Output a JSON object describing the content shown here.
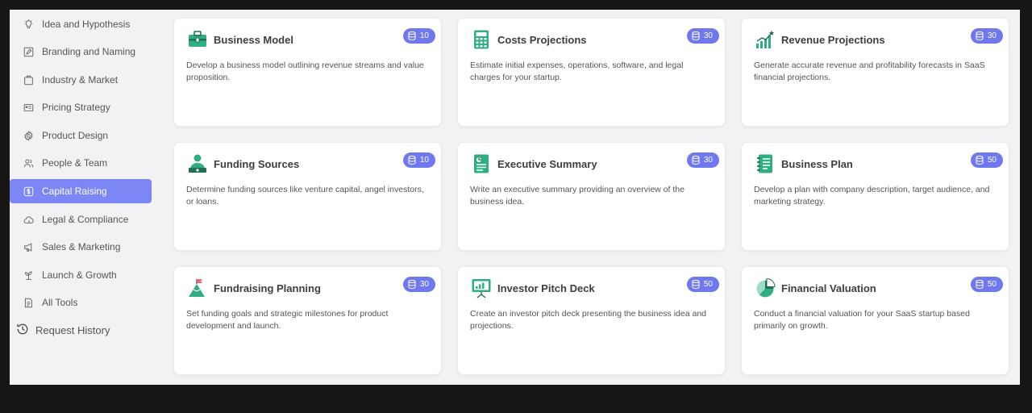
{
  "sidebar": {
    "items": [
      {
        "label": "Idea and Hypothesis",
        "icon": "lightbulb-icon",
        "active": false
      },
      {
        "label": "Branding and Naming",
        "icon": "edit-icon",
        "active": false
      },
      {
        "label": "Industry & Market",
        "icon": "briefcase-icon",
        "active": false
      },
      {
        "label": "Pricing Strategy",
        "icon": "price-tag-icon",
        "active": false
      },
      {
        "label": "Product Design",
        "icon": "gear-icon",
        "active": false
      },
      {
        "label": "People & Team",
        "icon": "people-icon",
        "active": false
      },
      {
        "label": "Capital Raising",
        "icon": "dollar-coin-icon",
        "active": true
      },
      {
        "label": "Legal & Compliance",
        "icon": "cloud-icon",
        "active": false
      },
      {
        "label": "Sales & Marketing",
        "icon": "megaphone-icon",
        "active": false
      },
      {
        "label": "Launch & Growth",
        "icon": "plant-icon",
        "active": false
      },
      {
        "label": "All Tools",
        "icon": "document-icon",
        "active": false
      }
    ],
    "history_label": "Request History"
  },
  "cards": [
    {
      "title": "Business Model",
      "badge": "10",
      "icon": "toolbox-icon",
      "desc": "Develop a business model outlining revenue streams and value proposition."
    },
    {
      "title": "Costs Projections",
      "badge": "30",
      "icon": "calculator-icon",
      "desc": "Estimate initial expenses, operations, software, and legal charges for your startup."
    },
    {
      "title": "Revenue Projections",
      "badge": "30",
      "icon": "bar-chart-icon",
      "desc": "Generate accurate revenue and profitability forecasts in SaaS financial projections."
    },
    {
      "title": "Funding Sources",
      "badge": "10",
      "icon": "investor-icon",
      "desc": "Determine funding sources like venture capital, angel investors, or loans."
    },
    {
      "title": "Executive Summary",
      "badge": "30",
      "icon": "report-icon",
      "desc": "Write an executive summary providing an overview of the business idea."
    },
    {
      "title": "Business Plan",
      "badge": "50",
      "icon": "notebook-icon",
      "desc": "Develop a plan with company description, target audience, and marketing strategy."
    },
    {
      "title": "Fundraising Planning",
      "badge": "30",
      "icon": "mountain-flag-icon",
      "desc": "Set funding goals and strategic milestones for product development and launch."
    },
    {
      "title": "Investor Pitch Deck",
      "badge": "50",
      "icon": "presentation-icon",
      "desc": "Create an investor pitch deck presenting the business idea and projections."
    },
    {
      "title": "Financial Valuation",
      "badge": "50",
      "icon": "pie-chart-icon",
      "desc": "Conduct a financial valuation for your SaaS startup based primarily on growth."
    }
  ],
  "colors": {
    "accent": "#7c86f4",
    "badge": "#7078ef",
    "icon_green": "#2fae82"
  }
}
